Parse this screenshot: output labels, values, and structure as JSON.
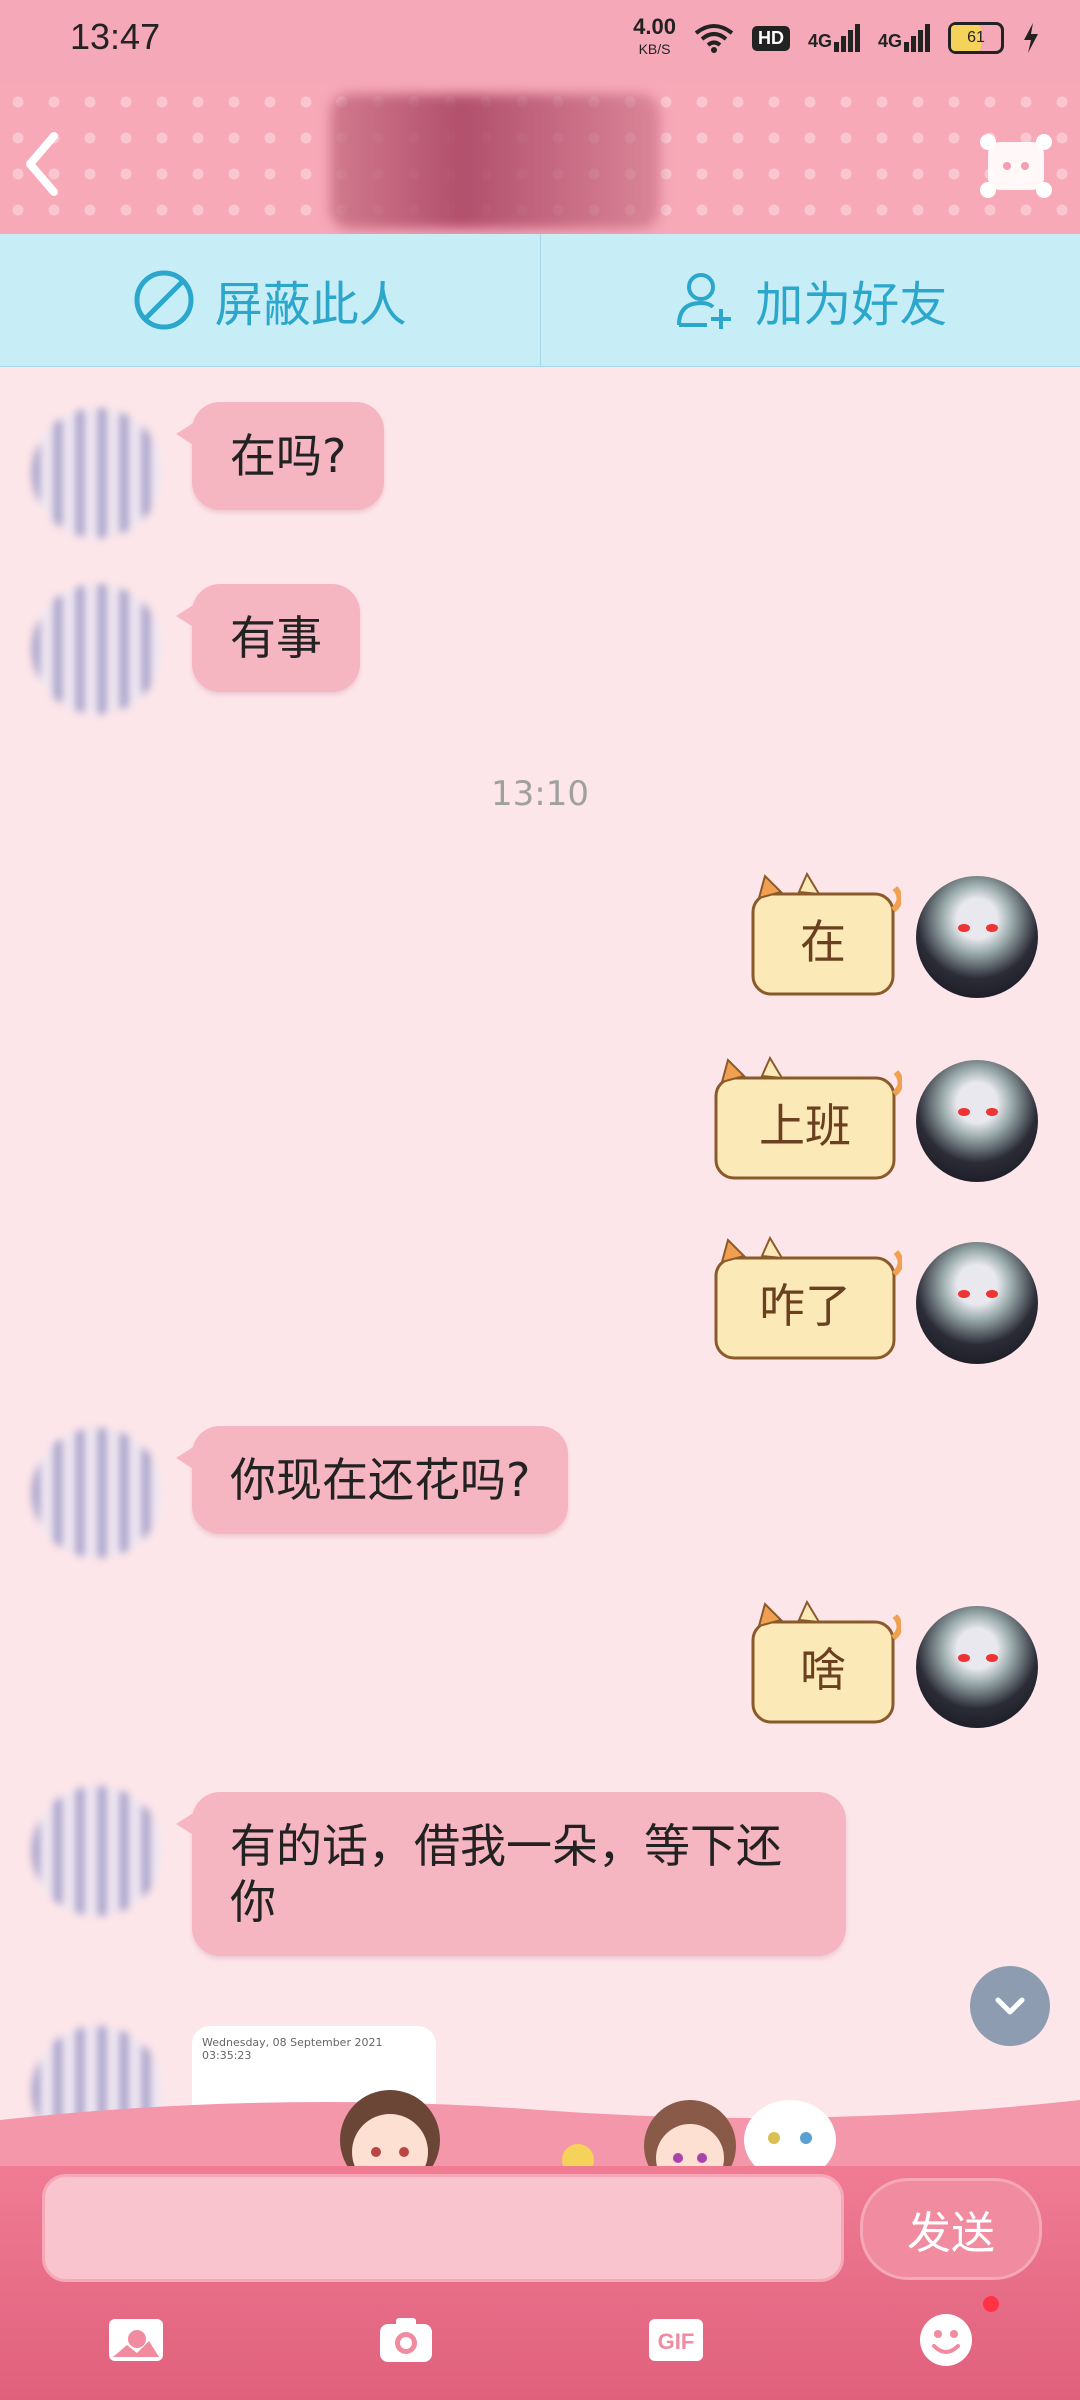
{
  "status_bar": {
    "time": "13:47",
    "net_speed": "4.00",
    "net_unit": "KB/S",
    "hd_badge": "HD",
    "signal_1_label": "4G",
    "signal_2_label": "4G",
    "battery": "61"
  },
  "action_bar": {
    "block_label": "屏蔽此人",
    "add_friend_label": "加为好友"
  },
  "messages": {
    "m1": "在吗?",
    "m2": "有事",
    "timestamp": "13:10",
    "s1": "在",
    "s2": "上班",
    "s3": "咋了",
    "m3": "你现在还花吗?",
    "s4": "啥",
    "m4": "有的话，借我一朵，等下还你"
  },
  "peek": {
    "text": "Wednesday, 08 September 2021 03:35:23"
  },
  "composer": {
    "input_value": "",
    "send_label": "发送"
  },
  "toolbar": {
    "gif_label": "GIF"
  },
  "colors": {
    "header_pink": "#f7a9b8",
    "action_bar_blue": "#c7edf7",
    "action_text": "#2ba7cc",
    "bubble_in": "#f6b6c1",
    "chat_bg": "#fde6ea"
  }
}
